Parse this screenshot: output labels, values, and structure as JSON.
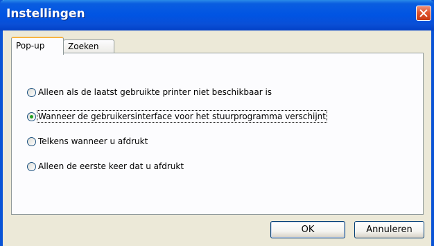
{
  "window": {
    "title": "Instellingen"
  },
  "tabs": [
    {
      "label": "Pop-up",
      "active": true
    },
    {
      "label": "Zoeken",
      "active": false
    }
  ],
  "options": [
    {
      "label": "Alleen als de laatst gebruikte printer niet beschikbaar is",
      "checked": false
    },
    {
      "label": "Wanneer de gebruikersinterface voor het stuurprogramma verschijnt",
      "checked": true
    },
    {
      "label": "Telkens wanneer u afdrukt",
      "checked": false
    },
    {
      "label": "Alleen de eerste keer dat u afdrukt",
      "checked": false
    }
  ],
  "buttons": {
    "ok": "OK",
    "cancel": "Annuleren"
  },
  "colors": {
    "titlebar": "#0054e3",
    "window_bg": "#ece9d8",
    "tab_highlight": "#f8b542"
  }
}
